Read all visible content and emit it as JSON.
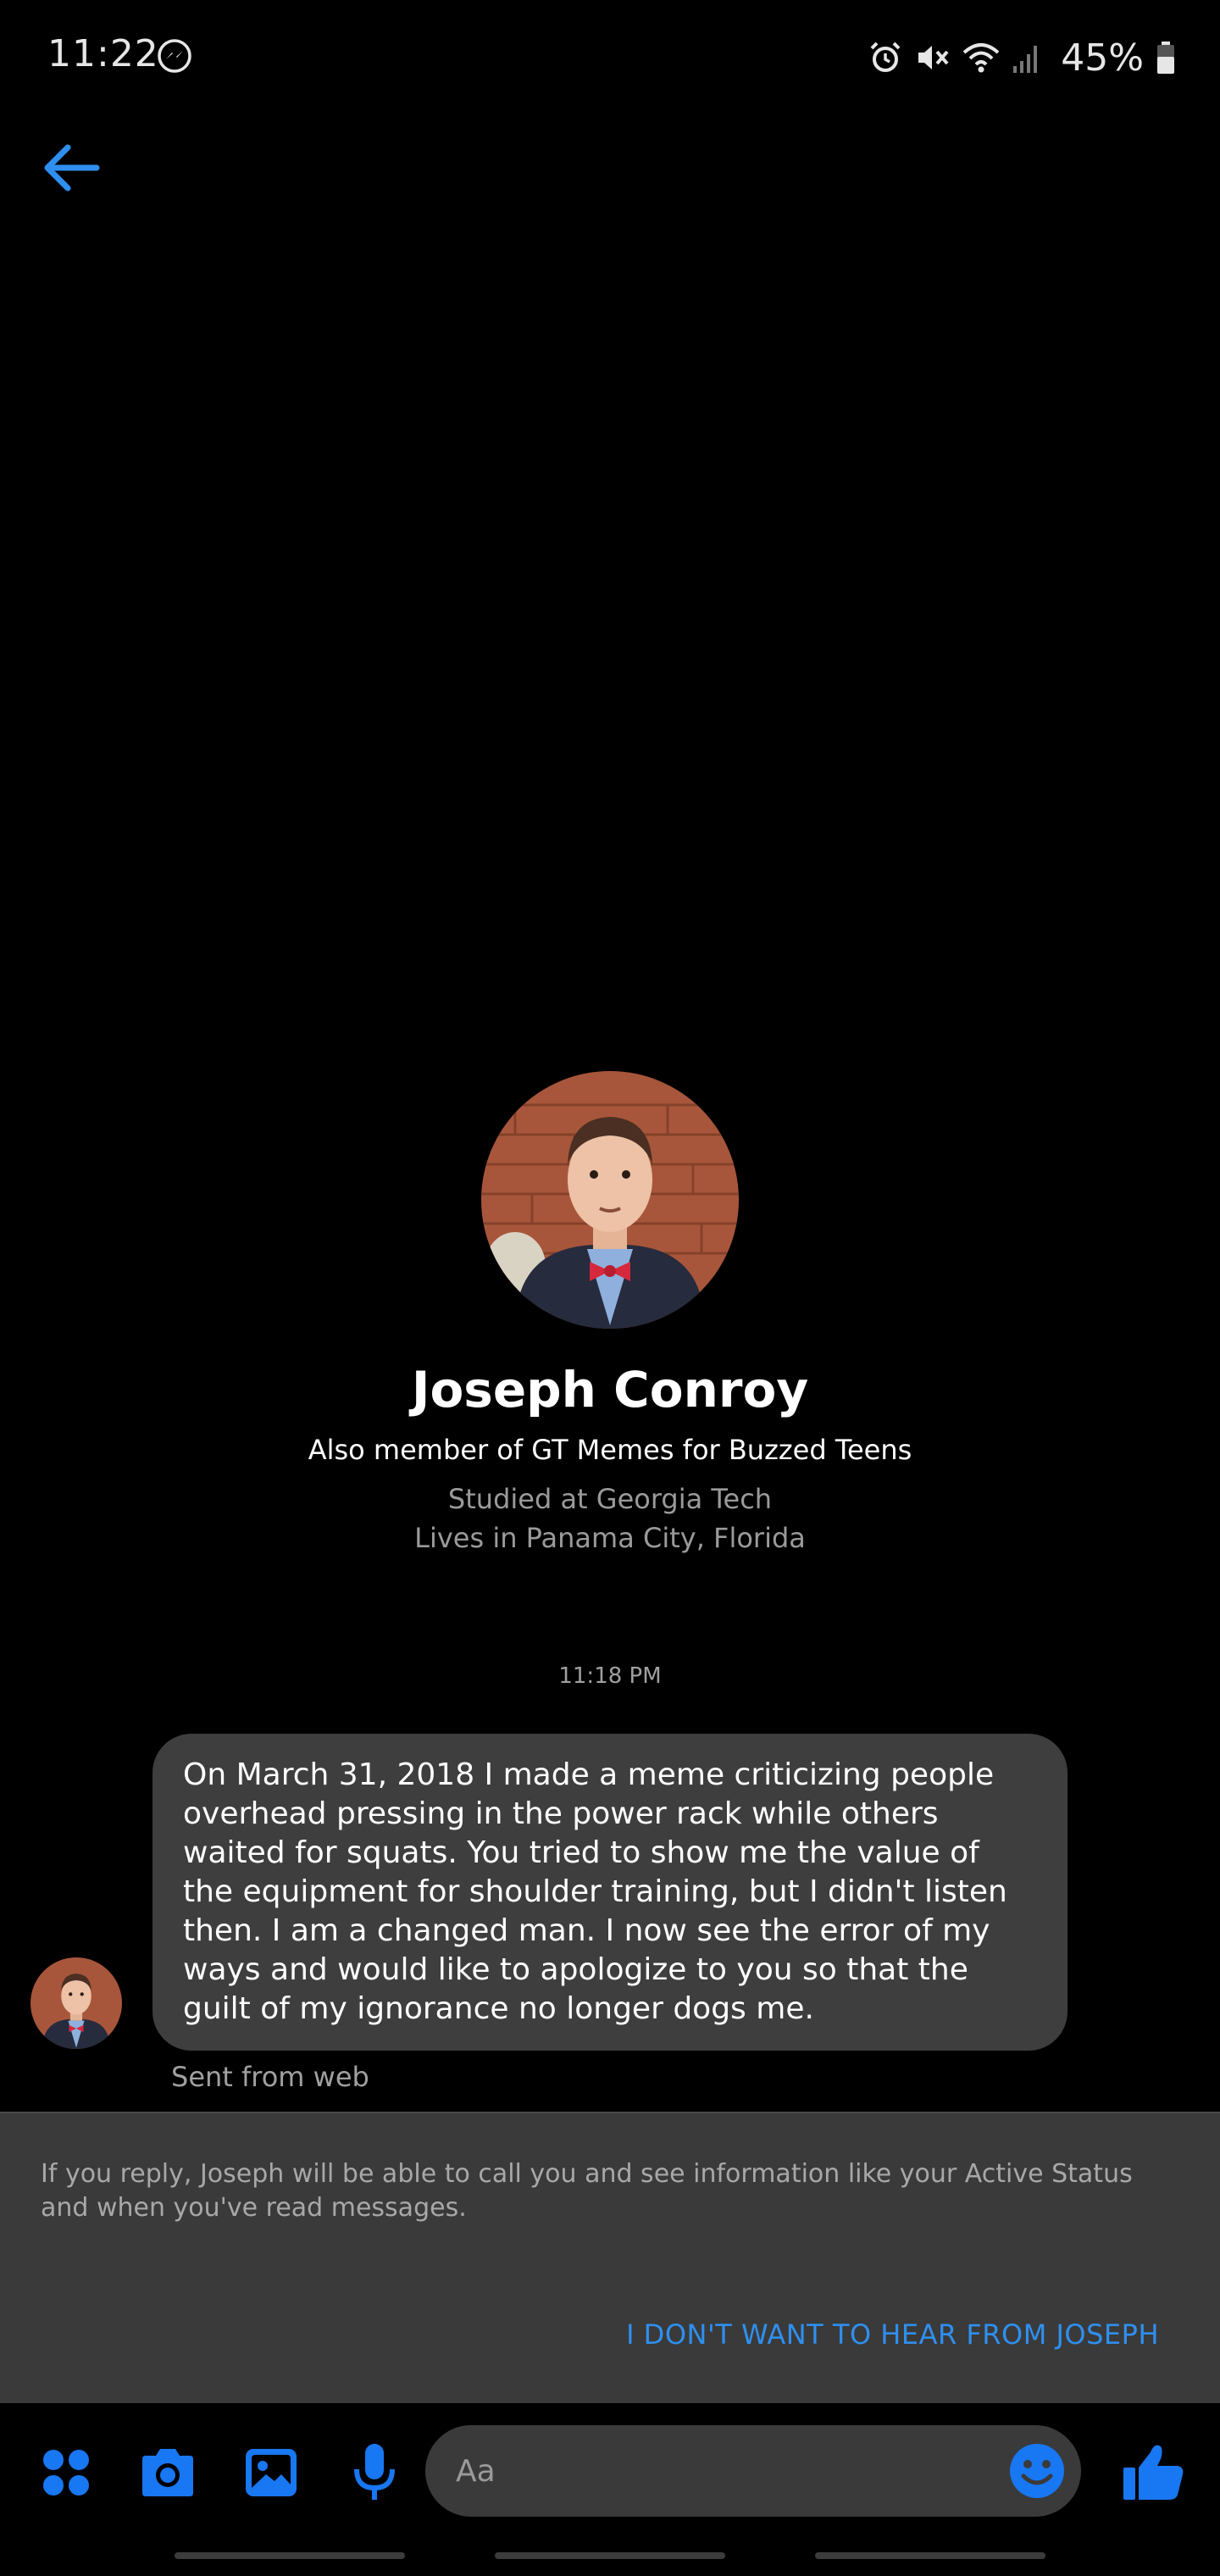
{
  "status_bar": {
    "time": "11:22",
    "battery": "45%",
    "icons": [
      "messenger-icon",
      "alarm-icon",
      "mute-icon",
      "wifi-icon",
      "signal-icon",
      "battery-icon"
    ]
  },
  "header": {
    "back_icon": "back-arrow-icon"
  },
  "profile": {
    "name": "Joseph Conroy",
    "group": "Also member of GT Memes for Buzzed Teens",
    "study": "Studied at Georgia Tech",
    "lives": "Lives in Panama City, Florida"
  },
  "conversation": {
    "timestamp": "11:18 PM",
    "message": "On March 31, 2018 I made a meme criticizing people overhead pressing in the power rack while others waited for squats. You tried to show me the value of the equipment for shoulder training, but I didn't listen then. I am a changed man. I now see the error of my ways and would like to apologize to you so that the guilt of my ignorance no longer dogs me.",
    "sent_from": "Sent from web"
  },
  "notice": {
    "text": "If you reply, Joseph will be able to call you and see information like your Active Status and when you've read messages.",
    "action": "I DON'T WANT TO HEAR FROM JOSEPH"
  },
  "composer": {
    "placeholder": "Aa",
    "icons": [
      "menu-dots-icon",
      "camera-icon",
      "gallery-icon",
      "microphone-icon",
      "emoji-icon",
      "thumbs-up-icon"
    ]
  },
  "colors": {
    "accent": "#2f8ff0",
    "background": "#000000",
    "bubble": "#3e3e3e",
    "panel": "#3a3a3a"
  }
}
